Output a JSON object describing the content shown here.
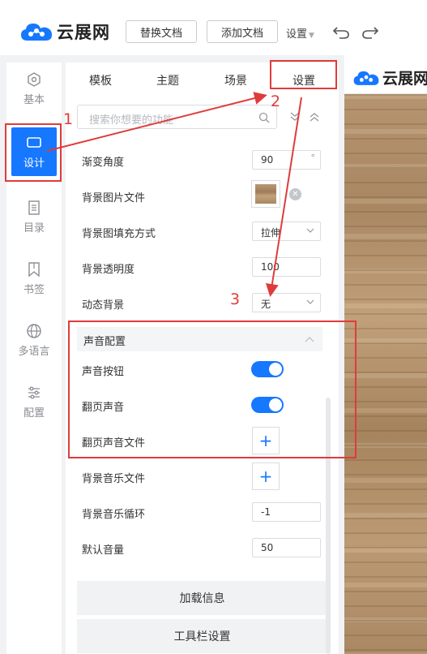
{
  "header": {
    "logo_text": "云展网",
    "replace_doc": "替换文档",
    "add_doc": "添加文档",
    "settings": "设置"
  },
  "rail": {
    "items": [
      {
        "label": "基本",
        "icon": "hexagon-icon"
      },
      {
        "label": "设计",
        "icon": "monitor-icon"
      },
      {
        "label": "目录",
        "icon": "list-icon"
      },
      {
        "label": "书签",
        "icon": "bookmark-icon"
      },
      {
        "label": "多语言",
        "icon": "globe-icon"
      },
      {
        "label": "配置",
        "icon": "sliders-icon"
      }
    ],
    "active": "设计"
  },
  "tabs": [
    "模板",
    "主题",
    "场景",
    "设置"
  ],
  "search": {
    "placeholder": "搜索你想要的功能"
  },
  "settings": {
    "gradient_angle": {
      "label": "渐变角度",
      "value": "90",
      "unit": "°"
    },
    "bg_image": {
      "label": "背景图片文件"
    },
    "bg_fill": {
      "label": "背景图填充方式",
      "value": "拉伸"
    },
    "bg_opacity": {
      "label": "背景透明度",
      "value": "100"
    },
    "dynamic_bg": {
      "label": "动态背景",
      "value": "无"
    },
    "sound_section": {
      "title": "声音配置"
    },
    "sound_button": {
      "label": "声音按钮",
      "on": true
    },
    "flip_sound": {
      "label": "翻页声音",
      "on": true
    },
    "flip_sound_file": {
      "label": "翻页声音文件"
    },
    "bg_music_file": {
      "label": "背景音乐文件"
    },
    "bg_music_loop": {
      "label": "背景音乐循环",
      "value": "-1"
    },
    "default_volume": {
      "label": "默认音量",
      "value": "50"
    }
  },
  "buttons": {
    "loading_info": "加载信息",
    "toolbar_settings": "工具栏设置"
  },
  "preview": {
    "logo_text": "云展网"
  },
  "annotations": [
    "1",
    "2",
    "3"
  ],
  "colors": {
    "accent": "#1677ff",
    "annotation": "#e03b3b"
  }
}
